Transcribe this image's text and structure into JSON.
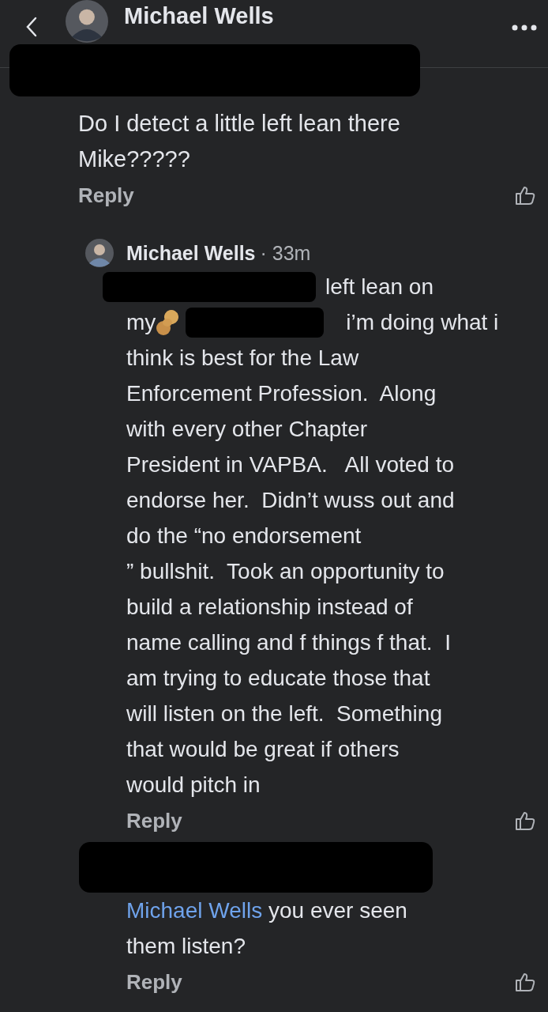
{
  "header": {
    "title": "Michael Wells"
  },
  "comment": {
    "text": "Do I detect a little left lean there\nMike?????",
    "reply": "Reply"
  },
  "replies": [
    {
      "kind": "segments",
      "author": "Michael Wells",
      "meta": "· 33m",
      "reply": "Reply",
      "segments": [
        {
          "kind": "redaction"
        },
        {
          "kind": "text",
          "text": "left lean on"
        },
        {
          "kind": "break"
        },
        {
          "kind": "text",
          "text": "my"
        },
        {
          "kind": "peanut"
        },
        {
          "kind": "redaction"
        },
        {
          "kind": "text",
          "text": "i’m doing what i"
        },
        {
          "kind": "break"
        },
        {
          "kind": "text",
          "text": "think is best for the Law\nEnforcement Profession.  Along\nwith every other Chapter\nPresident in VAPBA.   All voted to\nendorse her.  Didn’t wuss out and\ndo the “no endorsement\n” bullshit.  Took an opportunity to\nbuild a relationship instead of\nname calling and f things f that.  I\nam trying to educate those that\nwill listen on the left.  Something\nthat would be great if others\nwould pitch in"
        }
      ]
    },
    {
      "kind": "mention",
      "mention": "Michael Wells",
      "text": " you ever seen\nthem listen?",
      "reply": "Reply"
    }
  ]
}
